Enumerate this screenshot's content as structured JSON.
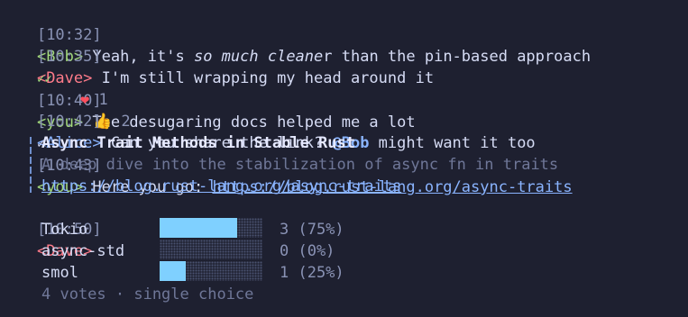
{
  "messages": [
    {
      "time": "[10:32]",
      "nick": "<Bob>",
      "text_a": " Yeah, it's ",
      "em": "so much cleane",
      "text_b": "r than the pin-based approach"
    },
    {
      "time": "[10:35]",
      "nick": "<Dave>",
      "text": " I'm still wrapping my head around it"
    },
    {
      "mark": "✓✓",
      "time": "[10:40]",
      "nick": "<you>",
      "text": " The desugaring docs helped me a lot"
    },
    {
      "time": "[10:42]",
      "nick": "<Alice>",
      "text_a": " Can you share the link? ",
      "mention": "@Bob",
      "text_b": " might want it too"
    },
    {
      "mark": "✓",
      "time": "[10:43]",
      "nick": "<you>",
      "text": " Here you go: ",
      "link": "https://blog.rust-lang.org/async-traits"
    },
    {
      "time": "[10:50]",
      "nick": "<Dave>"
    }
  ],
  "reactions": [
    {
      "emoji": "❤",
      "count": "1",
      "icon": "heart-icon"
    },
    {
      "emoji": "👍",
      "count": "2",
      "icon": "thumbs-up-icon"
    }
  ],
  "link_preview": {
    "title": "Async Trait Methods in Stable Rust",
    "description": "A deep dive into the stabilization of async fn in traits",
    "url": "https://blog.rust-lang.org/async-traits"
  },
  "poll": {
    "options": [
      {
        "label": "Tokio",
        "result": "3 (75%)",
        "fraction": 0.75
      },
      {
        "label": "async-std",
        "result": "0 (0%)",
        "fraction": 0
      },
      {
        "label": "smol",
        "result": "1 (25%)",
        "fraction": 0.25
      }
    ],
    "footer": "4 votes · single choice"
  },
  "colors": {
    "background": "#1e2030",
    "bob": "#a3d97c",
    "dave": "#ff7b8a",
    "alice": "#8ab4ff",
    "link": "#8ab4ff",
    "poll_fill": "#7fd0ff"
  }
}
